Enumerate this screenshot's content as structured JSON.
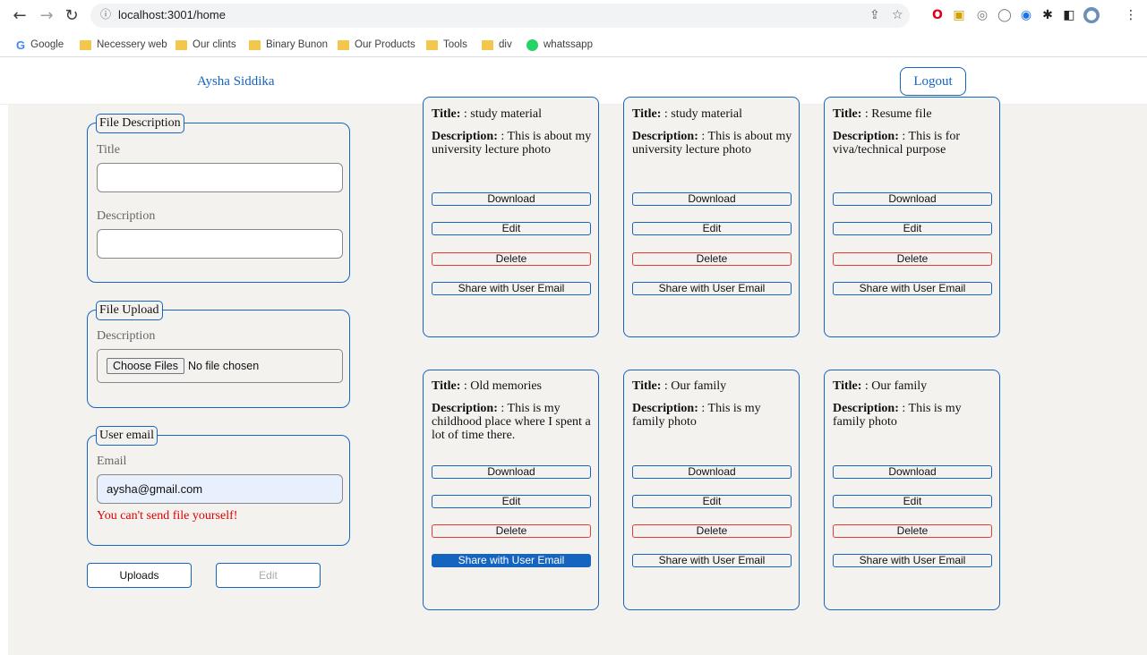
{
  "browser": {
    "url": "localhost:3001/home",
    "bookmarks": [
      "Google",
      "Necessery web",
      "Our clints",
      "Binary Bunon",
      "Our Products",
      "Tools",
      "div",
      "whatssapp"
    ]
  },
  "header": {
    "user_name": "Aysha Siddika",
    "logout_label": "Logout"
  },
  "form": {
    "file_description": {
      "legend": "File Description",
      "title_label": "Title",
      "title_value": "",
      "description_label": "Description",
      "description_value": ""
    },
    "file_upload": {
      "legend": "File Upload",
      "description_label": "Description",
      "choose_label": "Choose Files",
      "no_file_text": "No file chosen"
    },
    "user_email": {
      "legend": "User email",
      "email_label": "Email",
      "email_value": "aysha@gmail.com",
      "error": "You can't send file yourself!"
    },
    "uploads_label": "Uploads",
    "edit_label": "Edit"
  },
  "card_labels": {
    "title": "Title:",
    "description": "Description:",
    "download": "Download",
    "edit": "Edit",
    "delete": "Delete",
    "share": "Share with User Email"
  },
  "cards": [
    {
      "title": ": study material",
      "description": ": This is about my university lecture photo"
    },
    {
      "title": ": study material",
      "description": ": This is about my university lecture photo"
    },
    {
      "title": ": Resume file",
      "description": ": This is for viva/technical purpose"
    },
    {
      "title": ": Old memories",
      "description": ": This is my childhood place where I spent a lot of time there."
    },
    {
      "title": ": Our family",
      "description": ": This is my family photo"
    },
    {
      "title": ": Our family",
      "description": ": This is my family photo"
    }
  ]
}
